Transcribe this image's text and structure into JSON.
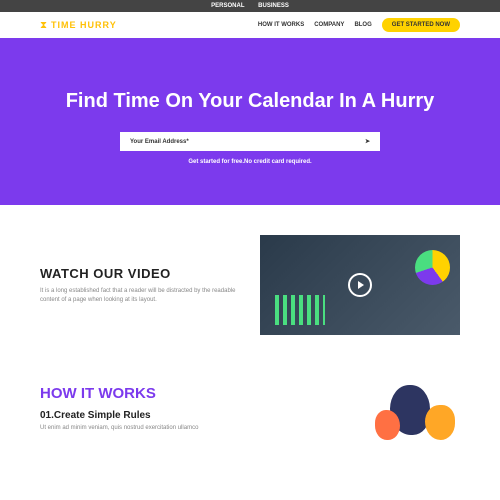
{
  "topbar": {
    "personal": "PERSONAL",
    "business": "BUSINESS"
  },
  "brand": {
    "name": "TIME HURRY"
  },
  "nav": {
    "how": "HOW IT WORKS",
    "company": "COMPANY",
    "blog": "BLOG",
    "cta": "GET STARTED NOW"
  },
  "hero": {
    "headline": "Find Time On Your Calendar In A Hurry",
    "placeholder": "Your Email Address*",
    "sub": "Get started for free.No credit card required."
  },
  "video": {
    "title": "WATCH OUR VIDEO",
    "desc": "It is a long established fact that a reader will be distracted by the readable content of a page when looking at its layout."
  },
  "how": {
    "title": "HOW IT WORKS",
    "step_title": "01.Create Simple Rules",
    "step_desc": "Ut enim ad minim veniam, quis nostrud exercitation ullamco"
  }
}
